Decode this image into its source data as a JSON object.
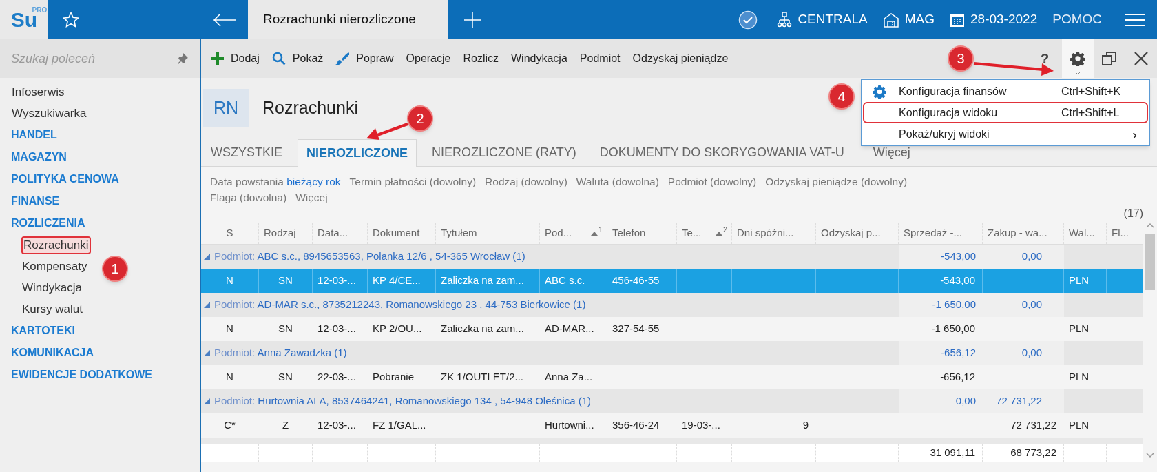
{
  "app": {
    "logo": "Su",
    "logo_badge": "PRO",
    "tab_title": "Rozrachunki nierozliczone",
    "status": [
      {
        "kind": "check"
      },
      {
        "kind": "org",
        "label": "CENTRALA"
      },
      {
        "kind": "warehouse",
        "label": "MAG"
      },
      {
        "kind": "calendar",
        "label": "28-03-2022"
      },
      {
        "kind": "text",
        "label": "POMOC"
      },
      {
        "kind": "menu"
      }
    ]
  },
  "sidebar": {
    "search": {
      "placeholder": "Szukaj poleceń"
    },
    "items": [
      {
        "label": "Infoserwis",
        "kind": "link",
        "marked": false
      },
      {
        "label": "Wyszukiwarka",
        "kind": "link",
        "marked": false
      },
      {
        "label": "HANDEL",
        "kind": "section",
        "marked": false
      },
      {
        "label": "MAGAZYN",
        "kind": "section",
        "marked": false
      },
      {
        "label": "POLITYKA CENOWA",
        "kind": "section",
        "marked": false
      },
      {
        "label": "FINANSE",
        "kind": "section",
        "marked": false
      },
      {
        "label": "ROZLICZENIA",
        "kind": "section",
        "marked": false,
        "children": [
          {
            "label": "Rozrachunki",
            "marked": true
          },
          {
            "label": "Kompensaty",
            "marked": false
          },
          {
            "label": "Windykacja",
            "marked": false
          },
          {
            "label": "Kursy walut",
            "marked": false
          }
        ]
      },
      {
        "label": "KARTOTEKI",
        "kind": "section",
        "marked": false
      },
      {
        "label": "KOMUNIKACJA",
        "kind": "section",
        "marked": false
      },
      {
        "label": "EWIDENCJE DODATKOWE",
        "kind": "section",
        "marked": false
      }
    ]
  },
  "toolbar": {
    "actions": [
      {
        "label": "Dodaj",
        "kind": "add"
      },
      {
        "label": "Pokaż",
        "kind": "search"
      },
      {
        "label": "Popraw",
        "kind": "edit"
      },
      {
        "label": "Operacje"
      },
      {
        "label": "Rozlicz"
      },
      {
        "label": "Windykacja"
      },
      {
        "label": "Podmiot"
      },
      {
        "label": "Odzyskaj pieniądze"
      }
    ],
    "help": "?",
    "tools": [
      {
        "kind": "settings",
        "selected": true
      },
      {
        "kind": "restore",
        "selected": false
      },
      {
        "kind": "close",
        "selected": false
      }
    ]
  },
  "settings_menu": [
    {
      "label": "Konfiguracja finansów",
      "shortcut": "Ctrl+Shift+K",
      "kind": "settings",
      "marked": false
    },
    {
      "label": "Konfiguracja widoku",
      "shortcut": "Ctrl+Shift+L",
      "marked": true
    },
    {
      "label": "Pokaż/ukryj widoki",
      "submenu": "›",
      "marked": false
    }
  ],
  "header": {
    "badge": "RN",
    "title": "Rozrachunki"
  },
  "tabs": [
    {
      "label": "WSZYSTKIE",
      "selected": false
    },
    {
      "label": "NIEROZLICZONE",
      "selected": true
    },
    {
      "label": "NIEROZLICZONE (RATY)",
      "selected": false
    },
    {
      "label": "DOKUMENTY DO SKORYGOWANIA VAT-U",
      "selected": false
    },
    {
      "label": "Więcej",
      "selected": false
    }
  ],
  "filters": [
    {
      "label": "Data powstania",
      "value": "bieżący rok"
    },
    {
      "label": "Termin płatności (dowolny)"
    },
    {
      "label": "Rodzaj (dowolny)"
    },
    {
      "label": "Waluta (dowolna)"
    },
    {
      "label": "Podmiot (dowolny)"
    },
    {
      "label": "Odzyskaj pieniądze (dowolny)"
    },
    {
      "label": "Flaga (dowolna)"
    },
    {
      "label": "Więcej"
    }
  ],
  "count": "(17)",
  "table": {
    "columns": [
      {
        "label": "S"
      },
      {
        "label": "Rodzaj"
      },
      {
        "label": "Data..."
      },
      {
        "label": "Dokument"
      },
      {
        "label": "Tytułem"
      },
      {
        "label": "Pod...",
        "sort_order": "1"
      },
      {
        "label": "Telefon"
      },
      {
        "label": "Te...",
        "sort_order": "2"
      },
      {
        "label": "Dni spóźni..."
      },
      {
        "label": "Odzyskaj p..."
      },
      {
        "label": "Sprzedaż -..."
      },
      {
        "label": "Zakup - wa..."
      },
      {
        "label": "Wal..."
      },
      {
        "label": "Fl..."
      }
    ],
    "rows": [
      {
        "kind": "group",
        "expanded": true,
        "label": "Podmiot:",
        "text": "ABC s.c., 8945653563, Polanka  12/6 , 54-365 Wrocław (1)",
        "sales": "-543,00",
        "purchase": "0,00"
      },
      {
        "kind": "row",
        "selected": true,
        "cells": [
          "N",
          "SN",
          "12-03-...",
          "KP 4/CE...",
          "Zaliczka na zam...",
          "ABC s.c.",
          "456-46-55",
          null,
          null,
          null,
          "-543,00",
          null,
          "PLN",
          null
        ]
      },
      {
        "kind": "group",
        "expanded": true,
        "label": "Podmiot:",
        "text": "AD-MAR s.c., 8735212243, Romanowskiego 23 , 44-753 Bierkowice (1)",
        "sales": "-1 650,00",
        "purchase": "0,00"
      },
      {
        "kind": "row",
        "selected": false,
        "cells": [
          "N",
          "SN",
          "12-03-...",
          "KP 2/OU...",
          "Zaliczka na zam...",
          "AD-MAR...",
          "327-54-55",
          null,
          null,
          null,
          "-1 650,00",
          null,
          "PLN",
          null
        ]
      },
      {
        "kind": "group",
        "expanded": true,
        "label": "Podmiot:",
        "text": "Anna Zawadzka (1)",
        "sales": "-656,12",
        "purchase": "0,00"
      },
      {
        "kind": "row",
        "selected": false,
        "cells": [
          "N",
          "SN",
          "22-03-...",
          "Pobranie",
          "ZK 1/OUTLET/2...",
          "Anna Za...",
          null,
          null,
          null,
          null,
          "-656,12",
          null,
          "PLN",
          null
        ]
      },
      {
        "kind": "group",
        "expanded": true,
        "label": "Podmiot:",
        "text": "Hurtownia ALA, 8537464241, Romanowskiego 134 , 54-948 Oleśnica (1)",
        "sales": "0,00",
        "purchase": "72 731,22"
      },
      {
        "kind": "row",
        "selected": false,
        "cells": [
          "C*",
          "Z",
          "12-03-...",
          "FZ 1/GAL...",
          null,
          "Hurtowni...",
          "356-46-24",
          "19-03-...",
          "9",
          null,
          null,
          "72 731,22",
          "PLN",
          null
        ]
      }
    ],
    "totals": {
      "sales": "31 091,11",
      "purchase": "68 773,22"
    }
  },
  "annotations": [
    {
      "label": "1"
    },
    {
      "label": "2"
    },
    {
      "label": "3"
    },
    {
      "label": "4"
    }
  ]
}
